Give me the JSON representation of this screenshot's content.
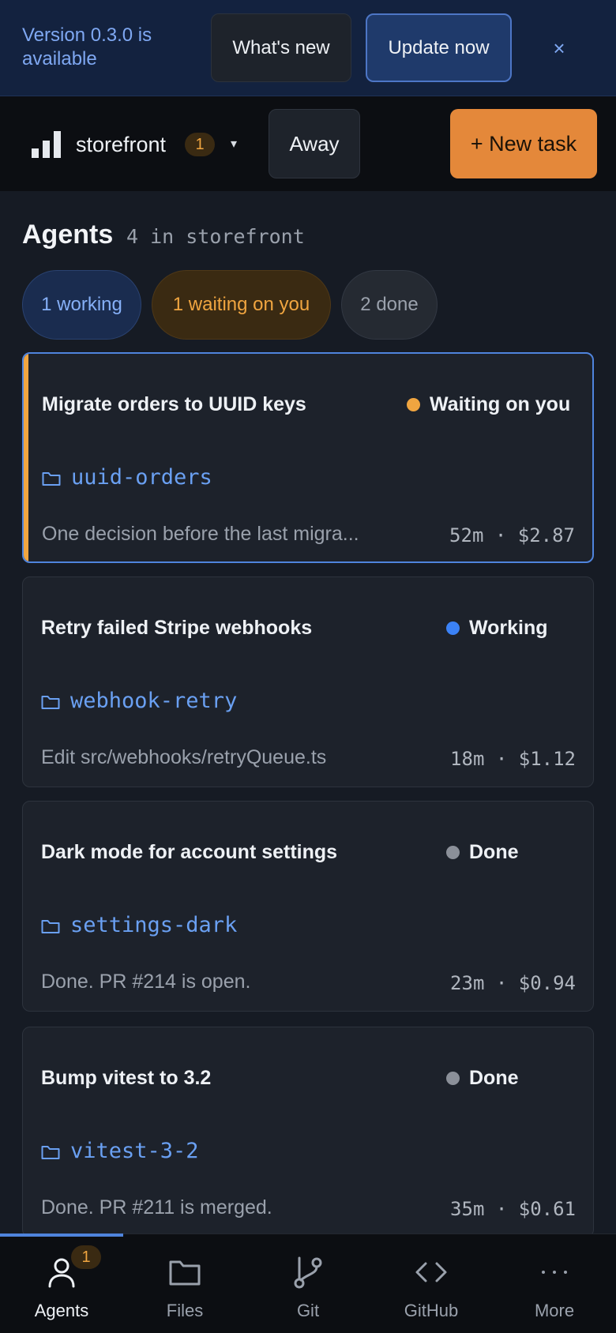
{
  "banner": {
    "text": "Version 0.3.0 is available",
    "whats_new_label": "What's new",
    "update_label": "Update now",
    "close_label": "×"
  },
  "header": {
    "project_name": "storefront",
    "project_badge": "1",
    "caret": "▾",
    "away_label": "Away",
    "new_task_label": "+ New task"
  },
  "agents": {
    "title": "Agents",
    "subtitle": "4 in storefront"
  },
  "filters": {
    "working": "1 working",
    "waiting": "1 waiting on you",
    "done": "2 done"
  },
  "colors": {
    "waiting": "#f0a540",
    "working": "#3b82f6",
    "done": "#8b9099",
    "accent": "#e4883a"
  },
  "tasks": [
    {
      "title": "Migrate orders to UUID keys",
      "status": "Waiting on you",
      "branch": "uuid-orders",
      "description": "One decision before the last migra...",
      "meta": "52m · $2.87"
    },
    {
      "title": "Retry failed Stripe webhooks",
      "status": "Working",
      "branch": "webhook-retry",
      "description": "Edit src/webhooks/retryQueue.ts",
      "meta": "18m · $1.12"
    },
    {
      "title": "Dark mode for account settings",
      "status": "Done",
      "branch": "settings-dark",
      "description": "Done. PR #214 is open.",
      "meta": "23m · $0.94"
    },
    {
      "title": "Bump vitest to 3.2",
      "status": "Done",
      "branch": "vitest-3-2",
      "description": "Done. PR #211 is merged.",
      "meta": "35m · $0.61"
    }
  ],
  "nav": {
    "items": [
      {
        "label": "Agents",
        "icon": "person-icon",
        "badge": "1"
      },
      {
        "label": "Files",
        "icon": "folder-icon"
      },
      {
        "label": "Git",
        "icon": "git-branch-icon"
      },
      {
        "label": "GitHub",
        "icon": "code-icon"
      },
      {
        "label": "More",
        "icon": "more-icon"
      }
    ]
  }
}
